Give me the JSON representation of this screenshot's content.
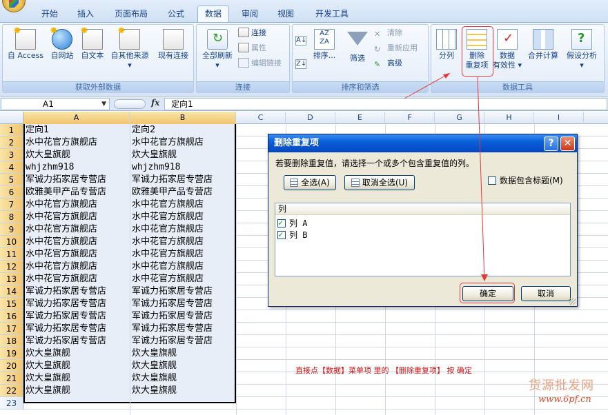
{
  "ribbon": {
    "tabs": [
      "开始",
      "插入",
      "页面布局",
      "公式",
      "数据",
      "审阅",
      "视图",
      "开发工具"
    ],
    "active_tab": "数据",
    "groups": {
      "external": {
        "label": "获取外部数据",
        "buttons": [
          "自 Access",
          "自网站",
          "自文本",
          "自其他来源",
          "现有连接"
        ]
      },
      "connections": {
        "label": "连接",
        "refresh_all": "全部刷新",
        "connections": "连接",
        "properties": "属性",
        "edit_links": "编辑链接"
      },
      "sort_filter": {
        "label": "排序和筛选",
        "sort": "排序...",
        "filter": "筛选",
        "clear": "清除",
        "reapply": "重新应用",
        "advanced": "高级"
      },
      "data_tools": {
        "label": "数据工具",
        "text_to_columns": "分列",
        "remove_dup_line1": "删除",
        "remove_dup_line2": "重复项",
        "validation_line1": "数据",
        "validation_line2": "有效性",
        "consolidate": "合并计算",
        "what_if": "假设分析"
      }
    }
  },
  "formula_bar": {
    "name_box": "A1",
    "fx": "fx",
    "formula": "定向1"
  },
  "sheet": {
    "columns": [
      "A",
      "B",
      "C",
      "D",
      "E",
      "F",
      "G",
      "H",
      "I"
    ],
    "rows": [
      "1",
      "2",
      "3",
      "4",
      "5",
      "6",
      "7",
      "8",
      "9",
      "10",
      "11",
      "12",
      "13",
      "14",
      "15",
      "16",
      "17",
      "18",
      "19",
      "20",
      "21",
      "22",
      "23"
    ],
    "col_a": [
      "定向1",
      "水中花官方旗舰店",
      "炊大皇旗舰",
      "whjzhm918",
      "军诚力拓家居专营店",
      "欧雅美甲产品专营店",
      "水中花官方旗舰店",
      "水中花官方旗舰店",
      "水中花官方旗舰店",
      "水中花官方旗舰店",
      "水中花官方旗舰店",
      "水中花官方旗舰店",
      "水中花官方旗舰店",
      "军诚力拓家居专营店",
      "军诚力拓家居专营店",
      "军诚力拓家居专营店",
      "军诚力拓家居专营店",
      "军诚力拓家居专营店",
      "炊大皇旗舰",
      "炊大皇旗舰",
      "炊大皇旗舰",
      "炊大皇旗舰"
    ],
    "col_b": [
      "定向2",
      "水中花官方旗舰店",
      "炊大皇旗舰",
      "whjzhm918",
      "军诚力拓家居专营店",
      "欧雅美甲产品专营店",
      "水中花官方旗舰店",
      "水中花官方旗舰店",
      "水中花官方旗舰店",
      "水中花官方旗舰店",
      "水中花官方旗舰店",
      "水中花官方旗舰店",
      "水中花官方旗舰店",
      "军诚力拓家居专营店",
      "军诚力拓家居专营店",
      "军诚力拓家居专营店",
      "军诚力拓家居专营店",
      "军诚力拓家居专营店",
      "炊大皇旗舰",
      "炊大皇旗舰",
      "炊大皇旗舰",
      "炊大皇旗舰"
    ]
  },
  "dialog": {
    "title": "删除重复项",
    "help": "?",
    "close": "✕",
    "prompt": "若要删除重复值，请选择一个或多个包含重复值的列。",
    "select_all": "全选(A)",
    "unselect_all": "取消全选(U)",
    "header_checkbox": "数据包含标题(M)",
    "list_header": "列",
    "items": [
      "列 A",
      "列 B"
    ],
    "ok": "确定",
    "cancel": "取消"
  },
  "annotation": {
    "caption": "直接点【数据】菜单项 里的 【删除重复项】 按 确定",
    "highlight_color": "#e23a3a"
  },
  "watermark": {
    "line1": "货源批发网",
    "line2": "www.6pf.cn"
  }
}
